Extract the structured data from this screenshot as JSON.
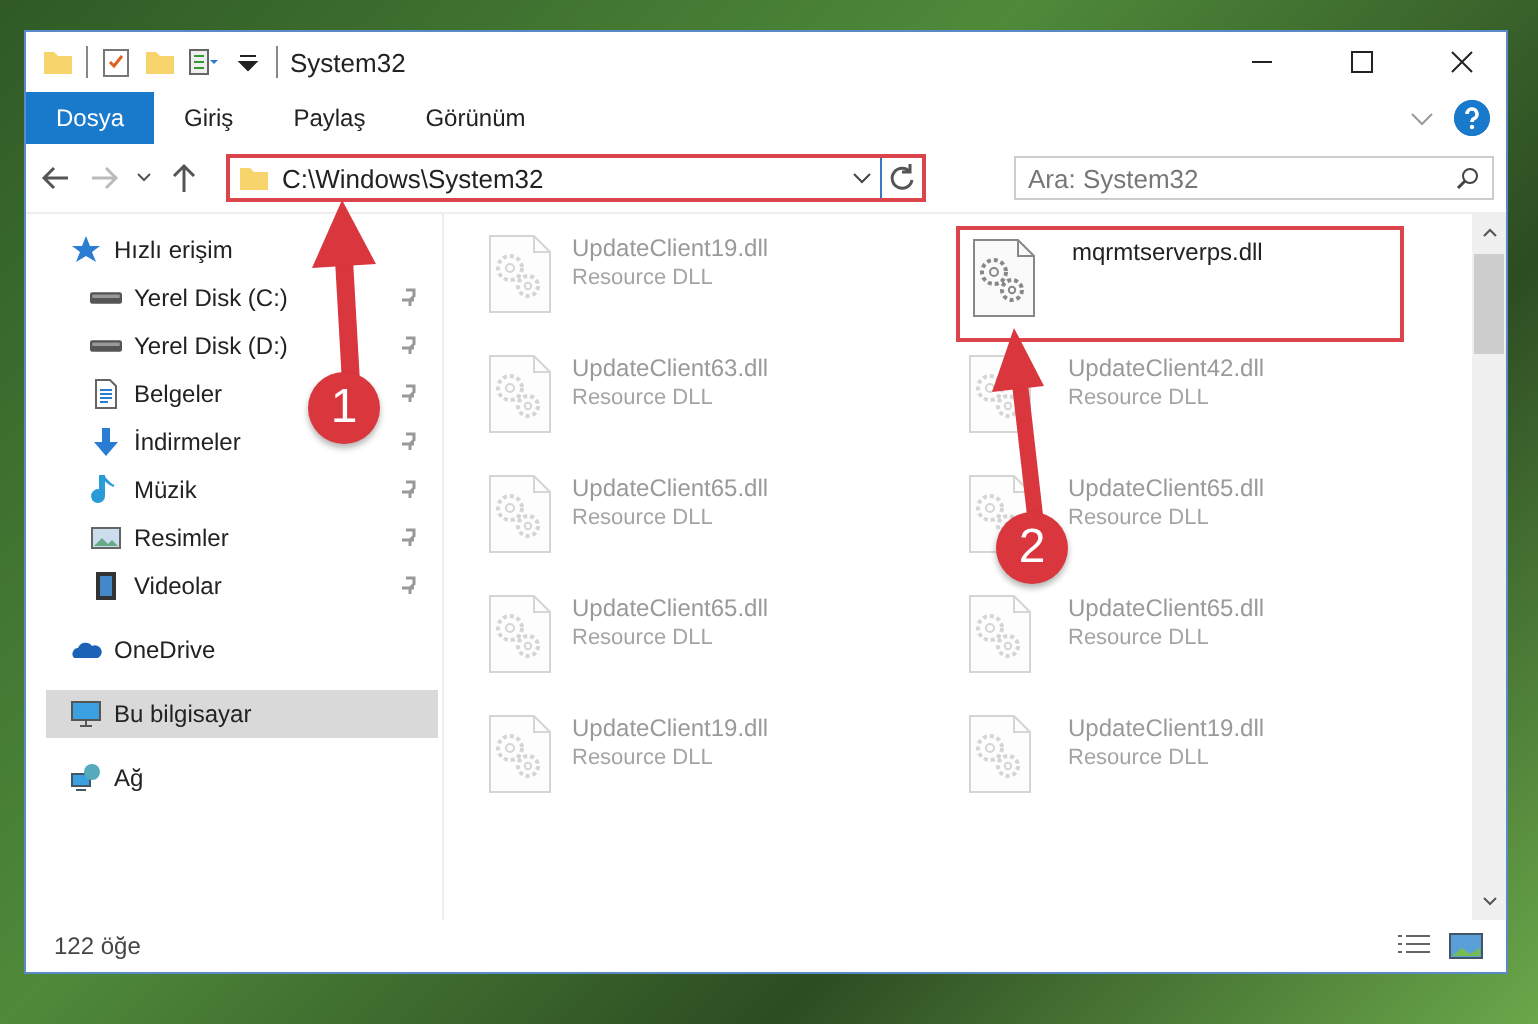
{
  "window": {
    "title": "System32"
  },
  "ribbon_tabs": [
    {
      "label": "Dosya",
      "selected": true
    },
    {
      "label": "Giriş",
      "selected": false
    },
    {
      "label": "Paylaş",
      "selected": false
    },
    {
      "label": "Görünüm",
      "selected": false
    }
  ],
  "address_bar": {
    "value": "C:\\Windows\\System32",
    "highlighted": true
  },
  "search": {
    "placeholder": "Ara: System32"
  },
  "sidebar": {
    "items": [
      {
        "label": "Hızlı erişim",
        "kind": "star",
        "selected": false,
        "children": [
          {
            "label": "Yerel Disk (C:)",
            "kind": "drive",
            "selected": false
          },
          {
            "label": "Yerel Disk (D:)",
            "kind": "drive",
            "selected": false
          },
          {
            "label": "Belgeler",
            "kind": "document",
            "selected": false
          },
          {
            "label": "İndirmeler",
            "kind": "download",
            "selected": false
          },
          {
            "label": "Müzik",
            "kind": "music",
            "selected": false
          },
          {
            "label": "Resimler",
            "kind": "picture",
            "selected": false
          },
          {
            "label": "Videolar",
            "kind": "video",
            "selected": false
          }
        ]
      },
      {
        "label": "OneDrive",
        "kind": "cloud",
        "selected": false
      },
      {
        "label": "Bu bilgisayar",
        "kind": "computer",
        "selected": true
      },
      {
        "label": "Ağ",
        "kind": "network",
        "selected": false
      }
    ]
  },
  "files": [
    {
      "name": "UpdateClient19.dll",
      "type": "Resource DLL",
      "faded": true,
      "highlighted": false
    },
    {
      "name": "mqrmtserverps.dll",
      "faded": false,
      "highlighted": true
    },
    {
      "name": "UpdateClient63.dll",
      "type": "Resource DLL",
      "faded": true,
      "highlighted": false
    },
    {
      "name": "UpdateClient42.dll",
      "type": "Resource DLL",
      "faded": true,
      "highlighted": false
    },
    {
      "name": "UpdateClient65.dll",
      "type": "Resource DLL",
      "faded": true,
      "highlighted": false
    },
    {
      "name": "UpdateClient65.dll",
      "type": "Resource DLL",
      "faded": true,
      "highlighted": false
    },
    {
      "name": "UpdateClient65.dll",
      "type": "Resource DLL",
      "faded": true,
      "highlighted": false
    },
    {
      "name": "UpdateClient65.dll",
      "type": "Resource DLL",
      "faded": true,
      "highlighted": false
    },
    {
      "name": "UpdateClient19.dll",
      "type": "Resource DLL",
      "faded": true,
      "highlighted": false
    },
    {
      "name": "UpdateClient19.dll",
      "type": "Resource DLL",
      "faded": true,
      "highlighted": false
    }
  ],
  "status_bar": {
    "item_count": "122 öğe"
  },
  "annotations": [
    {
      "label": "1"
    },
    {
      "label": "2"
    }
  ]
}
